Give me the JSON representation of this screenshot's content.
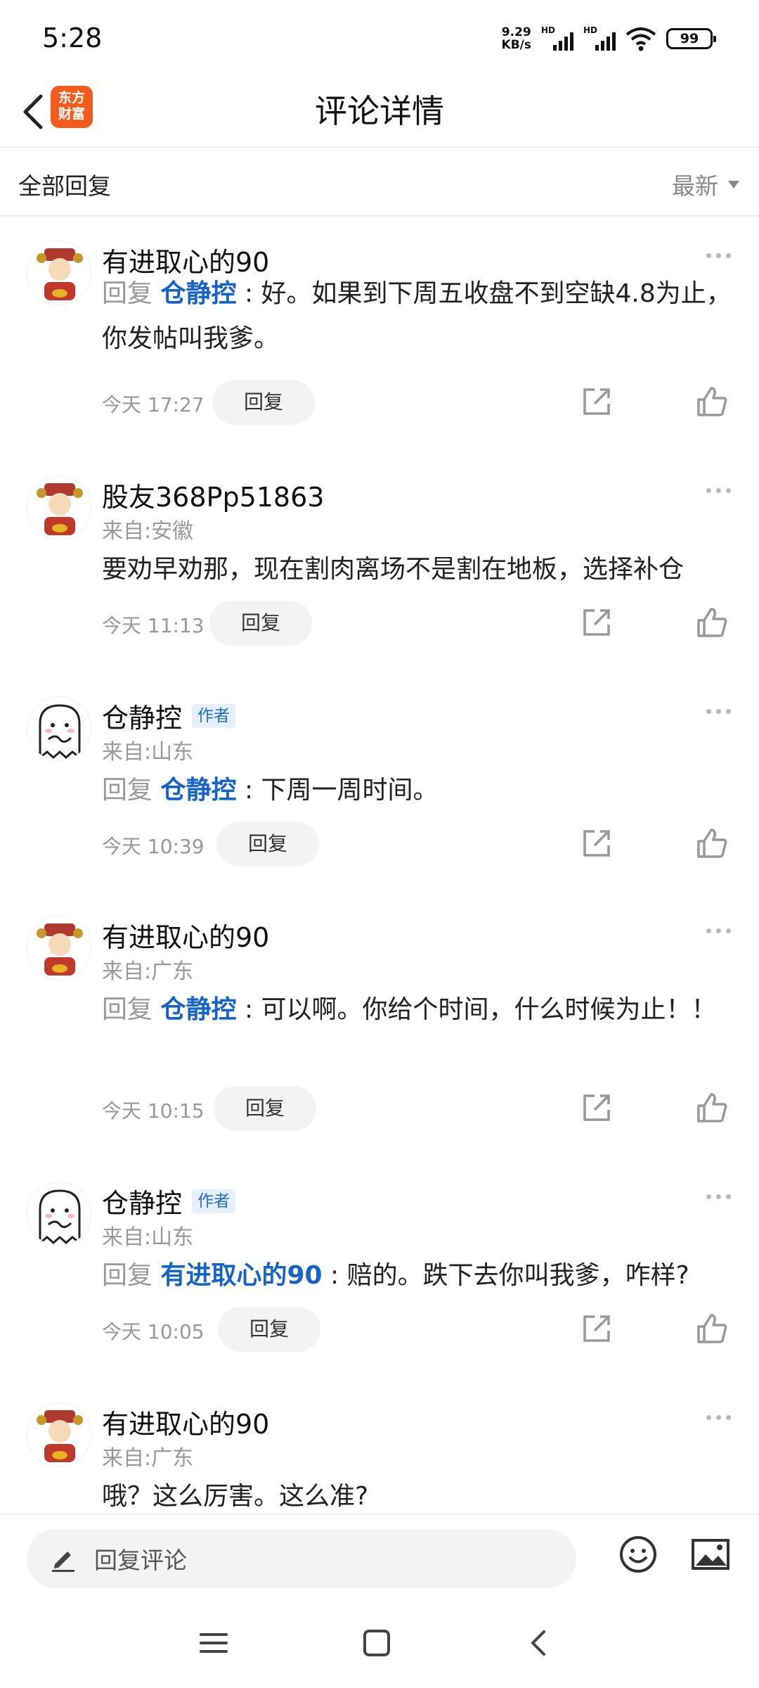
{
  "status_bar": {
    "time": "5:28",
    "net_speed_value": "9.29",
    "net_speed_unit": "KB/s",
    "hd1": "HD",
    "hd2": "HD",
    "battery": "99"
  },
  "nav": {
    "title": "评论详情",
    "logo_line1": "东方",
    "logo_line2": "财富"
  },
  "sort": {
    "title": "全部回复",
    "selected": "最新"
  },
  "comments": [
    {
      "username": "有进取心的90",
      "is_author": false,
      "location": "",
      "reply_prefix": "回复",
      "reply_to": "仓静控",
      "text": ": 好。如果到下周五收盘不到空缺4.8为止，你发帖叫我爹。",
      "time": "今天 17:27",
      "reply_label": "回复"
    },
    {
      "username": "股友368Pp51863",
      "is_author": false,
      "location": "来自:安徽",
      "reply_prefix": "",
      "reply_to": "",
      "text": "要劝早劝那，现在割肉离场不是割在地板，选择补仓",
      "time": "今天 11:13",
      "reply_label": "回复"
    },
    {
      "username": "仓静控",
      "is_author": true,
      "author_label": "作者",
      "location": "来自:山东",
      "reply_prefix": "回复",
      "reply_to": "仓静控",
      "text": ": 下周一周时间。",
      "time": "今天 10:39",
      "reply_label": "回复"
    },
    {
      "username": "有进取心的90",
      "is_author": false,
      "location": "来自:广东",
      "reply_prefix": "回复",
      "reply_to": "仓静控",
      "text": ": 可以啊。你给个时间，什么时候为止！！",
      "time": "今天 10:15",
      "reply_label": "回复"
    },
    {
      "username": "仓静控",
      "is_author": true,
      "author_label": "作者",
      "location": "来自:山东",
      "reply_prefix": "回复",
      "reply_to": "有进取心的90",
      "text": ": 赔的。跌下去你叫我爹，咋样?",
      "time": "今天 10:05",
      "reply_label": "回复"
    },
    {
      "username": "有进取心的90",
      "is_author": false,
      "location": "来自:广东",
      "reply_prefix": "",
      "reply_to": "",
      "text": "哦？这么厉害。这么准?",
      "time": "",
      "reply_label": ""
    }
  ],
  "bottom_bar": {
    "input_placeholder": "回复评论"
  },
  "colors": {
    "mention": "#1664c8",
    "logo": "#f25b1c",
    "author_badge": "#1c6fd1"
  }
}
